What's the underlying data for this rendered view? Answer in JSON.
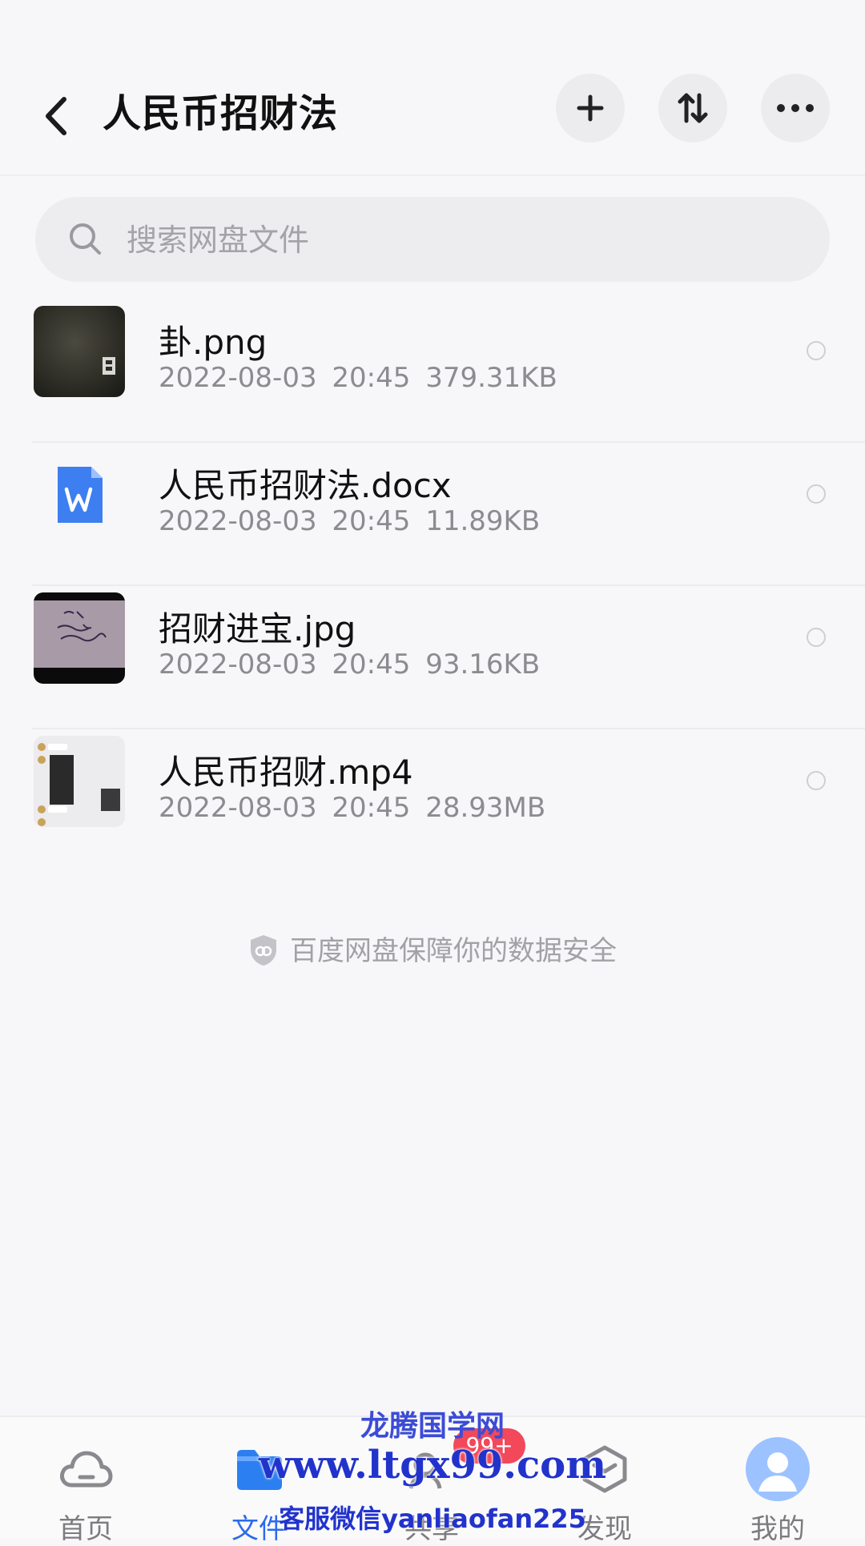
{
  "header": {
    "title": "人民币招财法"
  },
  "search": {
    "placeholder": "搜索网盘文件"
  },
  "files": [
    {
      "name": "卦.png",
      "date": "2022-08-03",
      "time": "20:45",
      "size": "379.31KB",
      "kind": "image"
    },
    {
      "name": "人民币招财法.docx",
      "date": "2022-08-03",
      "time": "20:45",
      "size": "11.89KB",
      "kind": "word-doc"
    },
    {
      "name": "招财进宝.jpg",
      "date": "2022-08-03",
      "time": "20:45",
      "size": "93.16KB",
      "kind": "image"
    },
    {
      "name": "人民币招财.mp4",
      "date": "2022-08-03",
      "time": "20:45",
      "size": "28.93MB",
      "kind": "video"
    }
  ],
  "security_note": "百度网盘保障你的数据安全",
  "nav": {
    "items": [
      {
        "label": "首页",
        "icon": "cloud-icon"
      },
      {
        "label": "文件",
        "icon": "folder-icon"
      },
      {
        "label": "共享",
        "icon": "share-icon"
      },
      {
        "label": "发现",
        "icon": "discover-icon"
      },
      {
        "label": "我的",
        "icon": "avatar-icon"
      }
    ],
    "badge": "99+"
  },
  "watermark": {
    "line1": "龙腾国学网",
    "line2": "www.ltgx99.com",
    "line3": "客服微信yanliaofan225"
  },
  "colors": {
    "accent": "#2b6bea",
    "badge": "#f2485a",
    "watermark": "#2233cc"
  }
}
